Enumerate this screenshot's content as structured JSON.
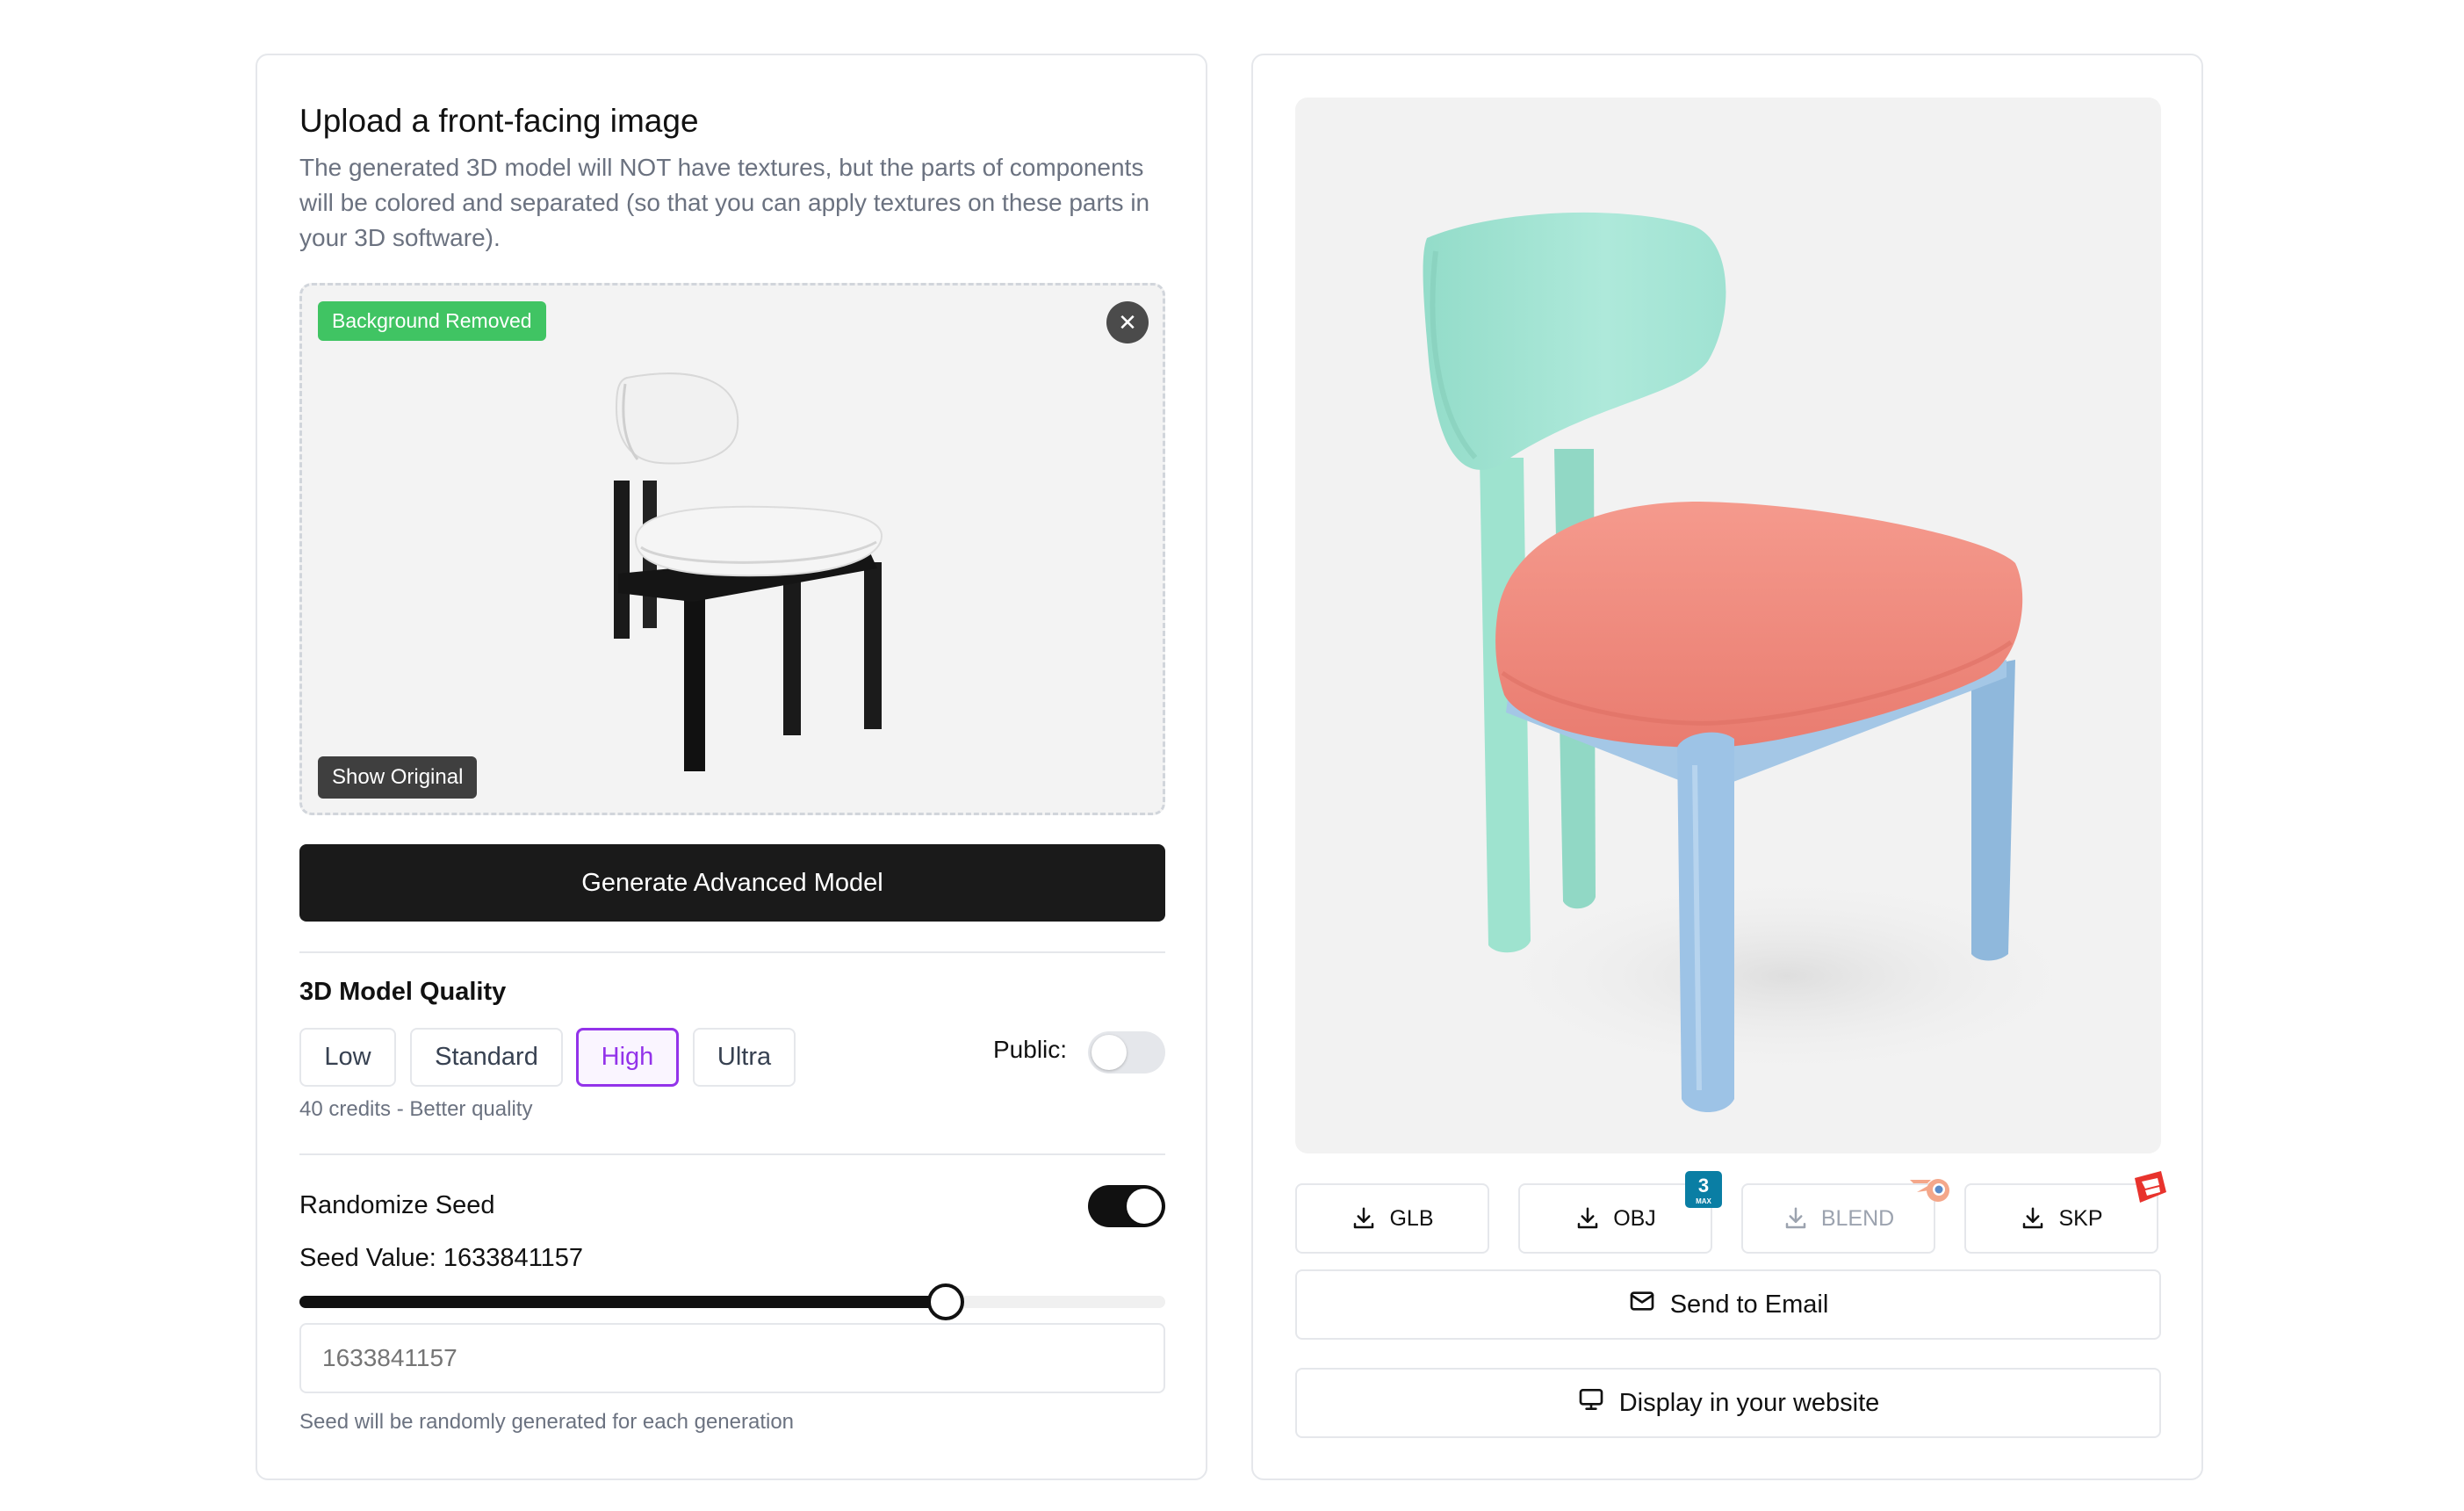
{
  "upload": {
    "title": "Upload a front-facing image",
    "description": "The generated 3D model will NOT have textures, but the parts of components will be colored and separated (so that you can apply textures on these parts in your 3D software).",
    "badge": "Background Removed",
    "close_icon": "close-icon",
    "show_original": "Show Original"
  },
  "generate_label": "Generate Advanced Model",
  "quality": {
    "label": "3D Model Quality",
    "options": [
      "Low",
      "Standard",
      "High",
      "Ultra"
    ],
    "selected": "High",
    "hint": "40 credits - Better quality"
  },
  "public": {
    "label": "Public:",
    "enabled": false
  },
  "seed": {
    "randomize_label": "Randomize Seed",
    "randomize_enabled": true,
    "value_label": "Seed Value: 1633841157",
    "slider_fraction": 0.746,
    "input_placeholder": "1633841157",
    "hint": "Seed will be randomly generated for each generation"
  },
  "downloads": {
    "glb": "GLB",
    "obj": "OBJ",
    "blend": "BLEND",
    "skp": "SKP",
    "obj_badge": "3",
    "obj_badge_sub": "MAX"
  },
  "actions": {
    "send_email": "Send to Email",
    "display_website": "Display in your website"
  },
  "colors": {
    "accent": "#9333ea",
    "badge_green": "#40c463",
    "chair_back": "#a3e6d6",
    "chair_seat": "#f08a7e",
    "chair_frame": "#9fc4e4"
  }
}
